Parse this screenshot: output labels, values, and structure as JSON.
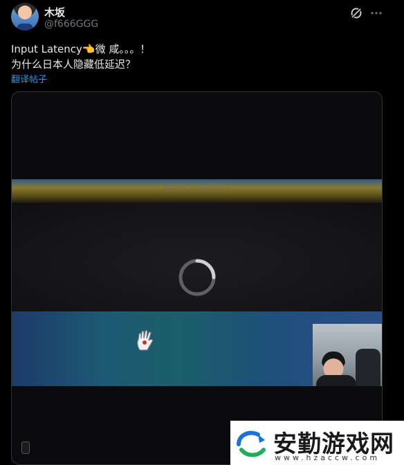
{
  "user": {
    "name": "木坂",
    "handle": "@f666GGG"
  },
  "icons": {
    "grok": "grok-icon",
    "more": "more-icon",
    "spinner": "loading-spinner",
    "hand": "hand-icon",
    "logo": "watermark-logo"
  },
  "post": {
    "line1": "Input Latency👈微 咸。。。！",
    "line2": "为什么日本人隐藏低延迟？",
    "translate_label": "翻译帖子"
  },
  "media": {
    "overlay_text": "Input Latency: 4"
  },
  "watermark": {
    "name": "安勤游戏网",
    "url": "www.hzaccw.com"
  },
  "colors": {
    "background": "#000000",
    "text": "#e7e9ea",
    "muted": "#71767b",
    "link": "#1d9bf0"
  }
}
